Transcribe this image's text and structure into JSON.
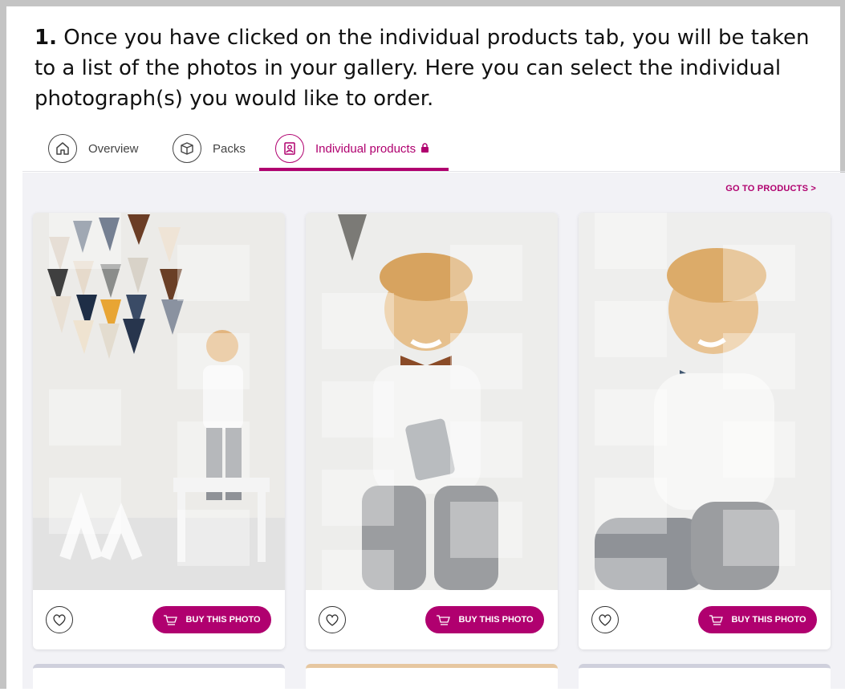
{
  "instruction": {
    "number": "1.",
    "text": "Once you have clicked on the individual products tab, you will be taken to a list of the photos in your gallery. Here you can select the individual photograph(s) you would like to order."
  },
  "tabs": [
    {
      "label": "Overview",
      "icon": "home-icon",
      "active": false
    },
    {
      "label": "Packs",
      "icon": "box-icon",
      "active": false
    },
    {
      "label": "Individual products",
      "icon": "photo-portrait-icon",
      "active": true,
      "badge_icon": "lock-icon"
    }
  ],
  "gallery": {
    "go_to_products": "GO TO PRODUCTS >",
    "cards": [
      {
        "buy_label": "BUY THIS PHOTO",
        "favorite_icon": "heart-icon",
        "cart_icon": "cart-icon"
      },
      {
        "buy_label": "BUY THIS PHOTO",
        "favorite_icon": "heart-icon",
        "cart_icon": "cart-icon"
      },
      {
        "buy_label": "BUY THIS PHOTO",
        "favorite_icon": "heart-icon",
        "cart_icon": "cart-icon"
      }
    ]
  },
  "colors": {
    "accent": "#b0006f",
    "gallery_background": "#f2f2f6"
  }
}
